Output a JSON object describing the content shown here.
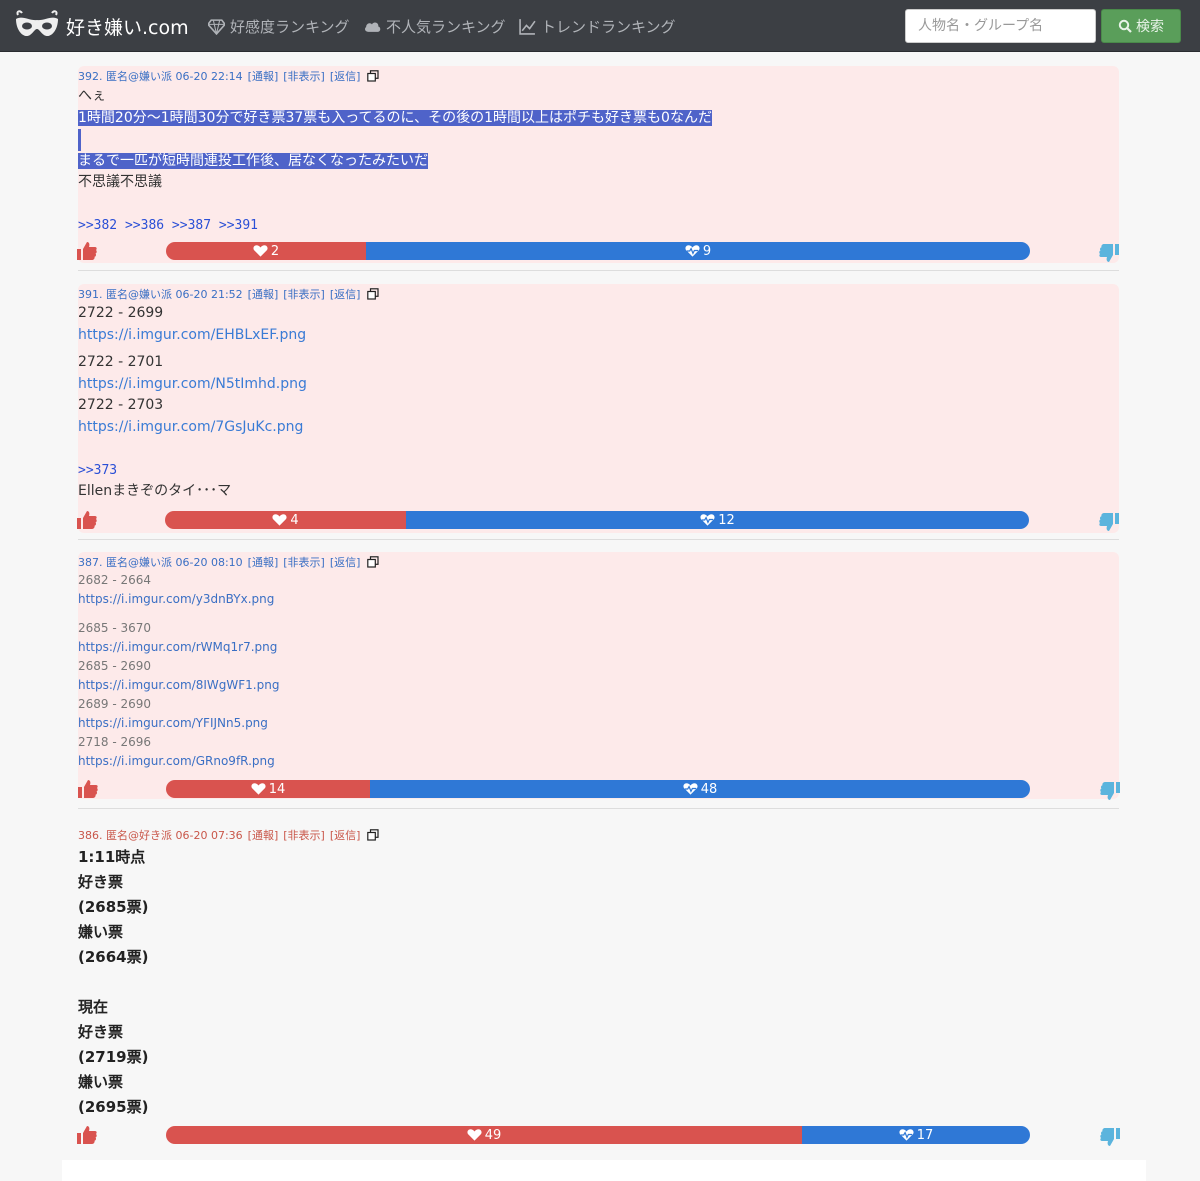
{
  "nav": {
    "brand": "好き嫌い.com",
    "items": [
      "好感度ランキング",
      "不人気ランキング",
      "トレンドランキング"
    ],
    "search_placeholder": "人物名・グループ名",
    "search_button": "検索"
  },
  "colors": {
    "navbar": "#3c3f44",
    "like": "#d9534f",
    "dislike": "#2f78d6",
    "search_button": "#5a9e5a",
    "post_bg": "#fdeaea"
  },
  "meta_links": {
    "report": "[通報]",
    "hide": "[非表示]",
    "reply": "[返信]"
  },
  "posts": [
    {
      "header": "392. 匿名@嫌い派 06-20 22:14",
      "lines": [
        "へぇ",
        "1時間20分〜1時間30分で好き票37票も入ってるのに、その後の1時間以上はポチも好き票も0なんだ",
        "",
        "まるで一匹が短時間連投工作後、居なくなったみたいだ",
        "不思議不思議",
        "",
        ">>382 >>386 >>387 >>391"
      ],
      "likes": "2",
      "dislikes": "9",
      "like_ratio": 0.18
    },
    {
      "header": "391. 匿名@嫌い派 06-20 21:52",
      "lines": [
        "2722 - 2699",
        "https://i.imgur.com/EHBLxEF.png",
        "2722 - 2701",
        "https://i.imgur.com/N5tImhd.png",
        "2722 - 2703",
        "https://i.imgur.com/7GsJuKc.png",
        "",
        ">>373",
        "Ellenまきぞのタイ･･･マ"
      ],
      "likes": "4",
      "dislikes": "12",
      "like_ratio": 0.25
    },
    {
      "header": "387. 匿名@嫌い派 06-20 08:10",
      "lines": [
        "2682 - 2664",
        "https://i.imgur.com/y3dnBYx.png",
        "2685 - 3670",
        "https://i.imgur.com/rWMq1r7.png",
        "2685 - 2690",
        "https://i.imgur.com/8IWgWF1.png",
        "2689 - 2690",
        "https://i.imgur.com/YFIJNn5.png",
        "2718 - 2696",
        "https://i.imgur.com/GRno9fR.png"
      ],
      "likes": "14",
      "dislikes": "48",
      "like_ratio": 0.23
    },
    {
      "header": "386. 匿名@好き派 06-20 07:36",
      "lines": [
        "1:11時点",
        "好き票",
        "(2685票)",
        "嫌い票",
        "(2664票)",
        "",
        "現在",
        "好き票",
        "(2719票)",
        "嫌い票",
        "(2695票)"
      ],
      "likes": "49",
      "dislikes": "17",
      "like_ratio": 0.74
    }
  ]
}
